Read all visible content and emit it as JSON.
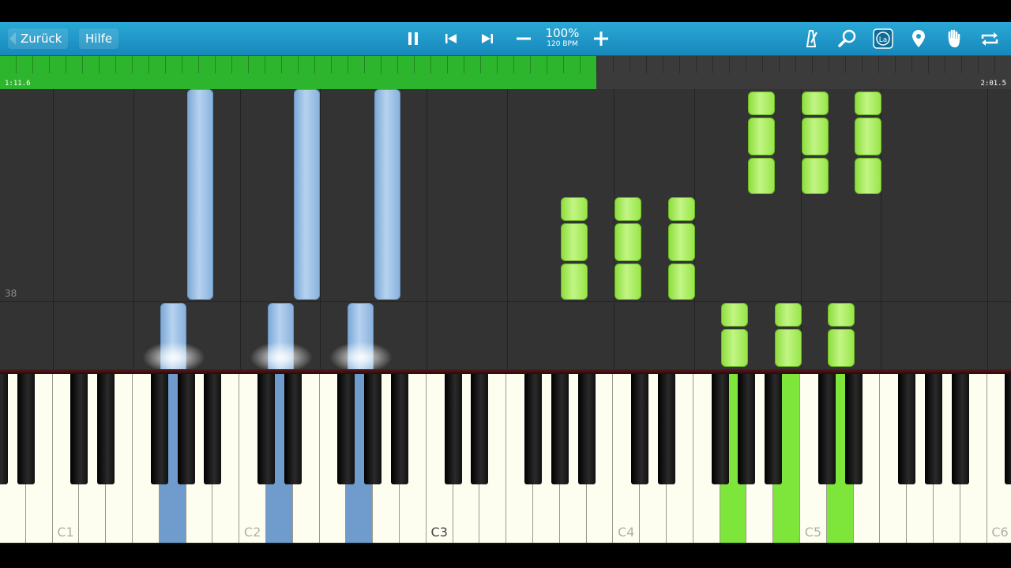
{
  "toolbar": {
    "back_label": "Zurück",
    "help_label": "Hilfe",
    "tempo_percent": "100%",
    "tempo_bpm": "120 BPM",
    "icons": [
      "pause-icon",
      "previous-icon",
      "next-icon",
      "minus-icon",
      "plus-icon",
      "metronome-icon",
      "magnifier-icon",
      "note-label-icon",
      "location-pin-icon",
      "hand-icon",
      "loop-icon"
    ]
  },
  "timeline": {
    "current_time": "1:11.6",
    "total_time": "2:01.5",
    "progress": 0.59
  },
  "roll": {
    "measure_number": "38"
  },
  "keyboard": {
    "labels": {
      "c1": "C1",
      "c2": "C2",
      "c3": "C3",
      "c4": "C4",
      "c5": "C5",
      "c6": "C6"
    }
  },
  "colors": {
    "toolbar": "#1f98c9",
    "progress": "#2db52d",
    "left_hand": "#7fa9d6",
    "right_hand": "#9be64a"
  }
}
